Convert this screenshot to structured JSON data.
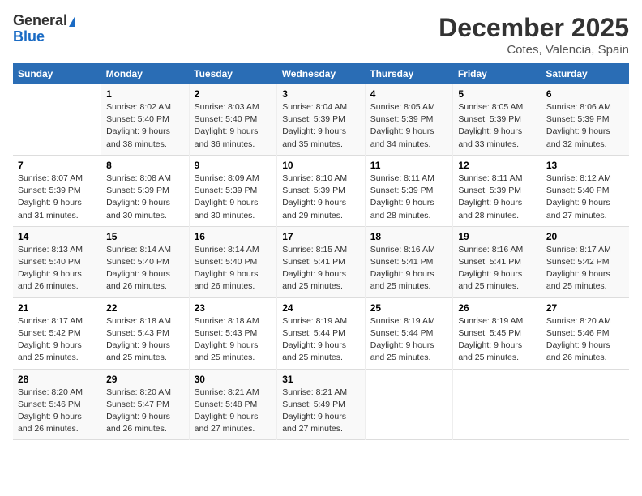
{
  "logo": {
    "general": "General",
    "blue": "Blue"
  },
  "title": "December 2025",
  "subtitle": "Cotes, Valencia, Spain",
  "headers": [
    "Sunday",
    "Monday",
    "Tuesday",
    "Wednesday",
    "Thursday",
    "Friday",
    "Saturday"
  ],
  "weeks": [
    [
      {
        "day": "",
        "content": ""
      },
      {
        "day": "1",
        "content": "Sunrise: 8:02 AM\nSunset: 5:40 PM\nDaylight: 9 hours\nand 38 minutes."
      },
      {
        "day": "2",
        "content": "Sunrise: 8:03 AM\nSunset: 5:40 PM\nDaylight: 9 hours\nand 36 minutes."
      },
      {
        "day": "3",
        "content": "Sunrise: 8:04 AM\nSunset: 5:39 PM\nDaylight: 9 hours\nand 35 minutes."
      },
      {
        "day": "4",
        "content": "Sunrise: 8:05 AM\nSunset: 5:39 PM\nDaylight: 9 hours\nand 34 minutes."
      },
      {
        "day": "5",
        "content": "Sunrise: 8:05 AM\nSunset: 5:39 PM\nDaylight: 9 hours\nand 33 minutes."
      },
      {
        "day": "6",
        "content": "Sunrise: 8:06 AM\nSunset: 5:39 PM\nDaylight: 9 hours\nand 32 minutes."
      }
    ],
    [
      {
        "day": "7",
        "content": "Sunrise: 8:07 AM\nSunset: 5:39 PM\nDaylight: 9 hours\nand 31 minutes."
      },
      {
        "day": "8",
        "content": "Sunrise: 8:08 AM\nSunset: 5:39 PM\nDaylight: 9 hours\nand 30 minutes."
      },
      {
        "day": "9",
        "content": "Sunrise: 8:09 AM\nSunset: 5:39 PM\nDaylight: 9 hours\nand 30 minutes."
      },
      {
        "day": "10",
        "content": "Sunrise: 8:10 AM\nSunset: 5:39 PM\nDaylight: 9 hours\nand 29 minutes."
      },
      {
        "day": "11",
        "content": "Sunrise: 8:11 AM\nSunset: 5:39 PM\nDaylight: 9 hours\nand 28 minutes."
      },
      {
        "day": "12",
        "content": "Sunrise: 8:11 AM\nSunset: 5:39 PM\nDaylight: 9 hours\nand 28 minutes."
      },
      {
        "day": "13",
        "content": "Sunrise: 8:12 AM\nSunset: 5:40 PM\nDaylight: 9 hours\nand 27 minutes."
      }
    ],
    [
      {
        "day": "14",
        "content": "Sunrise: 8:13 AM\nSunset: 5:40 PM\nDaylight: 9 hours\nand 26 minutes."
      },
      {
        "day": "15",
        "content": "Sunrise: 8:14 AM\nSunset: 5:40 PM\nDaylight: 9 hours\nand 26 minutes."
      },
      {
        "day": "16",
        "content": "Sunrise: 8:14 AM\nSunset: 5:40 PM\nDaylight: 9 hours\nand 26 minutes."
      },
      {
        "day": "17",
        "content": "Sunrise: 8:15 AM\nSunset: 5:41 PM\nDaylight: 9 hours\nand 25 minutes."
      },
      {
        "day": "18",
        "content": "Sunrise: 8:16 AM\nSunset: 5:41 PM\nDaylight: 9 hours\nand 25 minutes."
      },
      {
        "day": "19",
        "content": "Sunrise: 8:16 AM\nSunset: 5:41 PM\nDaylight: 9 hours\nand 25 minutes."
      },
      {
        "day": "20",
        "content": "Sunrise: 8:17 AM\nSunset: 5:42 PM\nDaylight: 9 hours\nand 25 minutes."
      }
    ],
    [
      {
        "day": "21",
        "content": "Sunrise: 8:17 AM\nSunset: 5:42 PM\nDaylight: 9 hours\nand 25 minutes."
      },
      {
        "day": "22",
        "content": "Sunrise: 8:18 AM\nSunset: 5:43 PM\nDaylight: 9 hours\nand 25 minutes."
      },
      {
        "day": "23",
        "content": "Sunrise: 8:18 AM\nSunset: 5:43 PM\nDaylight: 9 hours\nand 25 minutes."
      },
      {
        "day": "24",
        "content": "Sunrise: 8:19 AM\nSunset: 5:44 PM\nDaylight: 9 hours\nand 25 minutes."
      },
      {
        "day": "25",
        "content": "Sunrise: 8:19 AM\nSunset: 5:44 PM\nDaylight: 9 hours\nand 25 minutes."
      },
      {
        "day": "26",
        "content": "Sunrise: 8:19 AM\nSunset: 5:45 PM\nDaylight: 9 hours\nand 25 minutes."
      },
      {
        "day": "27",
        "content": "Sunrise: 8:20 AM\nSunset: 5:46 PM\nDaylight: 9 hours\nand 26 minutes."
      }
    ],
    [
      {
        "day": "28",
        "content": "Sunrise: 8:20 AM\nSunset: 5:46 PM\nDaylight: 9 hours\nand 26 minutes."
      },
      {
        "day": "29",
        "content": "Sunrise: 8:20 AM\nSunset: 5:47 PM\nDaylight: 9 hours\nand 26 minutes."
      },
      {
        "day": "30",
        "content": "Sunrise: 8:21 AM\nSunset: 5:48 PM\nDaylight: 9 hours\nand 27 minutes."
      },
      {
        "day": "31",
        "content": "Sunrise: 8:21 AM\nSunset: 5:49 PM\nDaylight: 9 hours\nand 27 minutes."
      },
      {
        "day": "",
        "content": ""
      },
      {
        "day": "",
        "content": ""
      },
      {
        "day": "",
        "content": ""
      }
    ]
  ]
}
